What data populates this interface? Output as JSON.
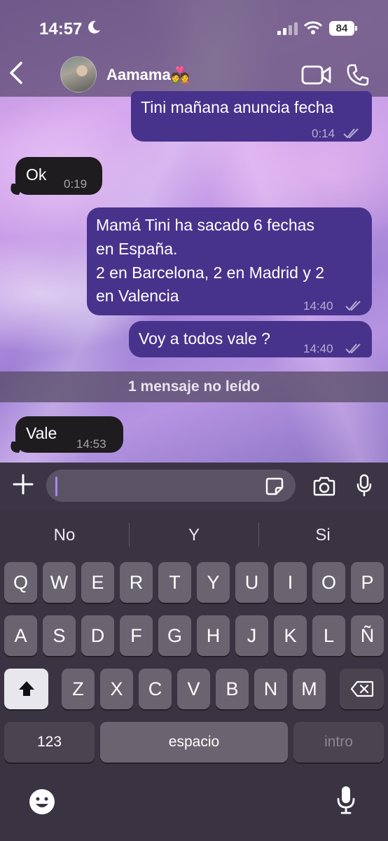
{
  "status": {
    "time": "14:57",
    "battery": "84"
  },
  "header": {
    "contact_name": "Aamama💑"
  },
  "messages": [
    {
      "direction": "out",
      "lines": [
        "Tini mañana anuncia fecha"
      ],
      "time": "0:14",
      "read": true
    },
    {
      "direction": "in",
      "lines": [
        "Ok"
      ],
      "time": "0:19"
    },
    {
      "direction": "out",
      "lines": [
        "Mamá Tini ha sacado 6 fechas",
        "en España.",
        "2 en Barcelona, 2 en Madrid y 2",
        "en Valencia"
      ],
      "time": "14:40",
      "read": true
    },
    {
      "direction": "out",
      "lines": [
        "Voy a todos vale ?"
      ],
      "time": "14:40",
      "read": true
    },
    {
      "direction": "in",
      "lines": [
        "Vale"
      ],
      "time": "14:53"
    }
  ],
  "unread_banner": "1 mensaje no leído",
  "composer": {
    "placeholder": ""
  },
  "keyboard": {
    "suggestions": [
      "No",
      "Y",
      "Si"
    ],
    "row1": [
      "Q",
      "W",
      "E",
      "R",
      "T",
      "Y",
      "U",
      "I",
      "O",
      "P"
    ],
    "row2": [
      "A",
      "S",
      "D",
      "F",
      "G",
      "H",
      "J",
      "K",
      "L",
      "Ñ"
    ],
    "row3": [
      "Z",
      "X",
      "C",
      "V",
      "B",
      "N",
      "M"
    ],
    "numbers_key": "123",
    "space_key": "espacio",
    "return_key": "intro"
  },
  "colors": {
    "outgoing_bubble": "#47338c",
    "incoming_bubble": "#1e1c1f",
    "accent": "#a48bf0"
  },
  "icons": [
    "back-icon",
    "video-call-icon",
    "phone-icon",
    "plus-icon",
    "sticker-icon",
    "camera-icon",
    "mic-icon",
    "shift-icon",
    "backspace-icon",
    "emoji-icon",
    "dictation-icon",
    "moon-icon",
    "signal-icon",
    "wifi-icon",
    "double-check-icon"
  ]
}
